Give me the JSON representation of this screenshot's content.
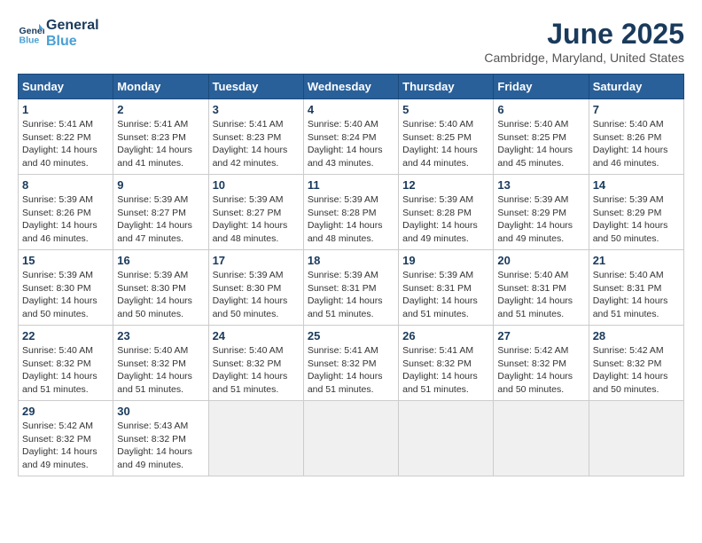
{
  "header": {
    "logo_line1": "General",
    "logo_line2": "Blue",
    "month_title": "June 2025",
    "location": "Cambridge, Maryland, United States"
  },
  "weekdays": [
    "Sunday",
    "Monday",
    "Tuesday",
    "Wednesday",
    "Thursday",
    "Friday",
    "Saturday"
  ],
  "days": [
    null,
    null,
    null,
    null,
    null,
    null,
    {
      "n": 1,
      "rise": "5:41 AM",
      "set": "8:22 PM",
      "dh": "14 hours and 40 minutes"
    },
    {
      "n": 2,
      "rise": "5:41 AM",
      "set": "8:23 PM",
      "dh": "14 hours and 41 minutes"
    },
    {
      "n": 3,
      "rise": "5:41 AM",
      "set": "8:23 PM",
      "dh": "14 hours and 42 minutes"
    },
    {
      "n": 4,
      "rise": "5:40 AM",
      "set": "8:24 PM",
      "dh": "14 hours and 43 minutes"
    },
    {
      "n": 5,
      "rise": "5:40 AM",
      "set": "8:25 PM",
      "dh": "14 hours and 44 minutes"
    },
    {
      "n": 6,
      "rise": "5:40 AM",
      "set": "8:25 PM",
      "dh": "14 hours and 45 minutes"
    },
    {
      "n": 7,
      "rise": "5:40 AM",
      "set": "8:26 PM",
      "dh": "14 hours and 46 minutes"
    },
    {
      "n": 8,
      "rise": "5:39 AM",
      "set": "8:26 PM",
      "dh": "14 hours and 46 minutes"
    },
    {
      "n": 9,
      "rise": "5:39 AM",
      "set": "8:27 PM",
      "dh": "14 hours and 47 minutes"
    },
    {
      "n": 10,
      "rise": "5:39 AM",
      "set": "8:27 PM",
      "dh": "14 hours and 48 minutes"
    },
    {
      "n": 11,
      "rise": "5:39 AM",
      "set": "8:28 PM",
      "dh": "14 hours and 48 minutes"
    },
    {
      "n": 12,
      "rise": "5:39 AM",
      "set": "8:28 PM",
      "dh": "14 hours and 49 minutes"
    },
    {
      "n": 13,
      "rise": "5:39 AM",
      "set": "8:29 PM",
      "dh": "14 hours and 49 minutes"
    },
    {
      "n": 14,
      "rise": "5:39 AM",
      "set": "8:29 PM",
      "dh": "14 hours and 50 minutes"
    },
    {
      "n": 15,
      "rise": "5:39 AM",
      "set": "8:30 PM",
      "dh": "14 hours and 50 minutes"
    },
    {
      "n": 16,
      "rise": "5:39 AM",
      "set": "8:30 PM",
      "dh": "14 hours and 50 minutes"
    },
    {
      "n": 17,
      "rise": "5:39 AM",
      "set": "8:30 PM",
      "dh": "14 hours and 50 minutes"
    },
    {
      "n": 18,
      "rise": "5:39 AM",
      "set": "8:31 PM",
      "dh": "14 hours and 51 minutes"
    },
    {
      "n": 19,
      "rise": "5:39 AM",
      "set": "8:31 PM",
      "dh": "14 hours and 51 minutes"
    },
    {
      "n": 20,
      "rise": "5:40 AM",
      "set": "8:31 PM",
      "dh": "14 hours and 51 minutes"
    },
    {
      "n": 21,
      "rise": "5:40 AM",
      "set": "8:31 PM",
      "dh": "14 hours and 51 minutes"
    },
    {
      "n": 22,
      "rise": "5:40 AM",
      "set": "8:32 PM",
      "dh": "14 hours and 51 minutes"
    },
    {
      "n": 23,
      "rise": "5:40 AM",
      "set": "8:32 PM",
      "dh": "14 hours and 51 minutes"
    },
    {
      "n": 24,
      "rise": "5:40 AM",
      "set": "8:32 PM",
      "dh": "14 hours and 51 minutes"
    },
    {
      "n": 25,
      "rise": "5:41 AM",
      "set": "8:32 PM",
      "dh": "14 hours and 51 minutes"
    },
    {
      "n": 26,
      "rise": "5:41 AM",
      "set": "8:32 PM",
      "dh": "14 hours and 51 minutes"
    },
    {
      "n": 27,
      "rise": "5:42 AM",
      "set": "8:32 PM",
      "dh": "14 hours and 50 minutes"
    },
    {
      "n": 28,
      "rise": "5:42 AM",
      "set": "8:32 PM",
      "dh": "14 hours and 50 minutes"
    },
    {
      "n": 29,
      "rise": "5:42 AM",
      "set": "8:32 PM",
      "dh": "14 hours and 49 minutes"
    },
    {
      "n": 30,
      "rise": "5:43 AM",
      "set": "8:32 PM",
      "dh": "14 hours and 49 minutes"
    },
    null,
    null,
    null,
    null,
    null
  ]
}
